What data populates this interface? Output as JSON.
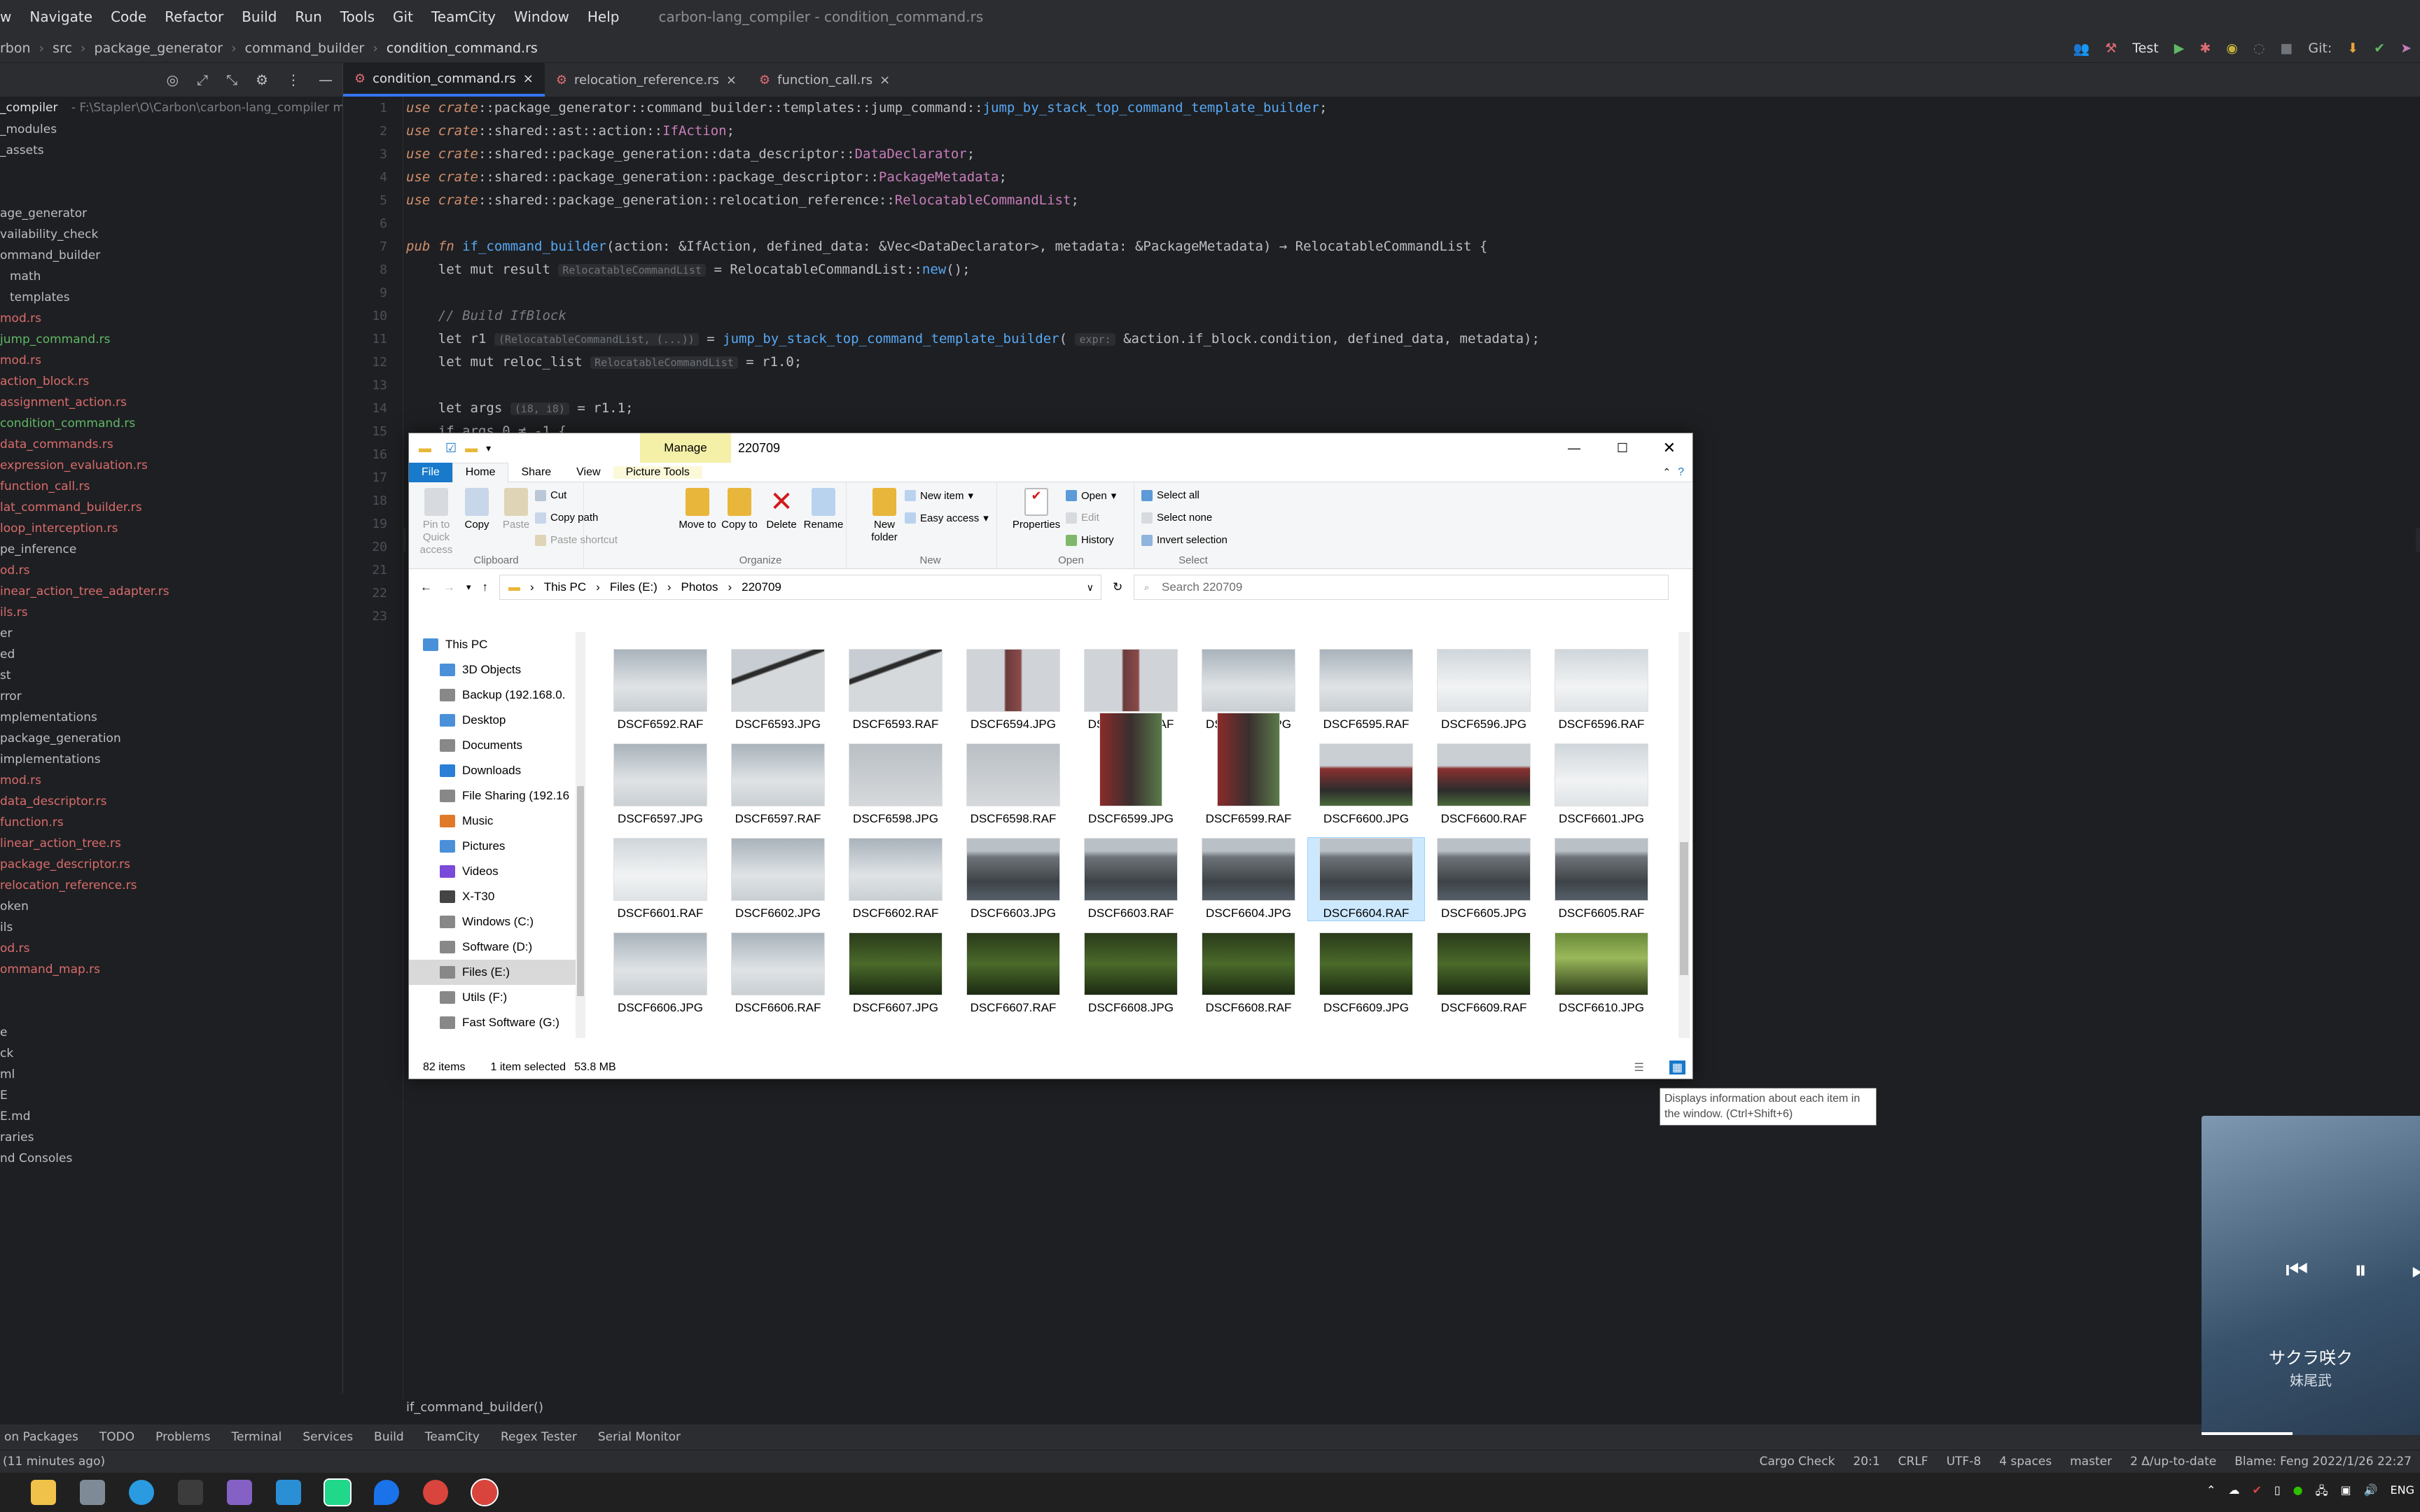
{
  "ide": {
    "menu": [
      "w",
      "Navigate",
      "Code",
      "Refactor",
      "Build",
      "Run",
      "Tools",
      "Git",
      "TeamCity",
      "Window",
      "Help"
    ],
    "window_title": "carbon-lang_compiler - condition_command.rs",
    "breadcrumb": [
      "rbon",
      "src",
      "package_generator",
      "command_builder",
      "condition_command.rs"
    ],
    "run_config": "Test",
    "git_label": "Git:",
    "project_root": "_compiler",
    "project_path": "- F:\\Stapler\\O\\Carbon\\carbon-lang_compiler mas",
    "tree": [
      "_modules",
      "_assets",
      "",
      "",
      "age_generator",
      "vailability_check",
      "ommand_builder",
      "math",
      "templates",
      "mod.rs",
      "jump_command.rs",
      "mod.rs",
      "action_block.rs",
      "assignment_action.rs",
      "condition_command.rs",
      "data_commands.rs",
      "expression_evaluation.rs",
      "function_call.rs",
      "lat_command_builder.rs",
      "loop_interception.rs",
      "pe_inference",
      "od.rs",
      "inear_action_tree_adapter.rs",
      "ils.rs",
      "er",
      "ed",
      "st",
      "rror",
      "mplementations",
      "package_generation",
      "implementations",
      "mod.rs",
      "data_descriptor.rs",
      "function.rs",
      "linear_action_tree.rs",
      "package_descriptor.rs",
      "relocation_reference.rs",
      "oken",
      "ils",
      "od.rs",
      "ommand_map.rs",
      "",
      "",
      "e",
      "ck",
      "ml",
      "E",
      "E.md",
      "raries",
      "nd Consoles"
    ],
    "tabs": [
      {
        "label": "condition_command.rs",
        "active": true
      },
      {
        "label": "relocation_reference.rs",
        "active": false
      },
      {
        "label": "function_call.rs",
        "active": false
      }
    ],
    "line_numbers": [
      "1",
      "2",
      "3",
      "4",
      "5",
      "6",
      "7",
      "8",
      "9",
      "10",
      "11",
      "12",
      "13",
      "14",
      "15",
      "16",
      "17",
      "18",
      "19",
      "20",
      "21",
      "22",
      "23"
    ],
    "code": {
      "l1": {
        "kw": "use crate",
        "p": "::package_generator::command_builder::templates::jump_command::",
        "fn": "jump_by_stack_top_command_template_builder",
        ";": ";"
      },
      "l2": {
        "kw": "use crate",
        "p": "::shared::ast::action::",
        "ty": "IfAction",
        ";": ";"
      },
      "l3": {
        "kw": "use crate",
        "p": "::shared::package_generation::data_descriptor::",
        "ty": "DataDeclarator",
        ";": ";"
      },
      "l4": {
        "kw": "use crate",
        "p": "::shared::package_generation::package_descriptor::",
        "ty": "PackageMetadata",
        ";": ";"
      },
      "l5": {
        "kw": "use crate",
        "p": "::shared::package_generation::relocation_reference::",
        "ty": "RelocatableCommandList",
        ";": ";"
      },
      "l7a": "pub fn ",
      "l7fn": "if_command_builder",
      "l7b": "(action: &IfAction, defined_data: &Vec<DataDeclarator>, metadata: &PackageMetadata) → RelocatableCommandList {",
      "l8a": "    let mut result ",
      "l8hint": "RelocatableCommandList",
      "l8b": " = RelocatableCommandList::",
      "l8fn": "new",
      "l8c": "();",
      "l10": "    // Build IfBlock",
      "l11a": "    let r1 ",
      "l11hint": "(RelocatableCommandList, (...))",
      "l11b": " = ",
      "l11fn": "jump_by_stack_top_command_template_builder",
      "l11hint2": "expr:",
      "l11c": "&action.if_block.condition, defined_data, metadata);",
      "l12a": "    let mut reloc_list ",
      "l12hint": "RelocatableCommandList",
      "l12b": " = r1.0;",
      "l14a": "    let args ",
      "l14hint": "(i8, i8)",
      "l14b": " = r1.1;",
      "l15": "    if args.0 ≠ -1 {"
    },
    "editor_breadcrumb": "if_command_builder()",
    "tool_windows": [
      "on Packages",
      "TODO",
      "Problems",
      "Terminal",
      "Services",
      "Build",
      "TeamCity",
      "Regex Tester",
      "Serial Monitor"
    ],
    "status_left": "(11 minutes ago)",
    "status_right": [
      "Cargo Check",
      "20:1",
      "CRLF",
      "UTF-8",
      "4 spaces",
      "master",
      "2 Δ/up-to-date",
      "Blame: Feng 2022/1/26 22:27"
    ]
  },
  "explorer": {
    "title": "220709",
    "manage_tab": "Manage",
    "picture_tools": "Picture Tools",
    "ribbon_tabs": [
      "File",
      "Home",
      "Share",
      "View"
    ],
    "clipboard": {
      "pin": "Pin to Quick access",
      "copy": "Copy",
      "paste": "Paste",
      "cut": "Cut",
      "copy_path": "Copy path",
      "paste_shortcut": "Paste shortcut",
      "label": "Clipboard"
    },
    "organize": {
      "move": "Move to",
      "copy": "Copy to",
      "delete": "Delete",
      "rename": "Rename",
      "label": "Organize"
    },
    "new": {
      "folder": "New folder",
      "item": "New item",
      "easy": "Easy access",
      "label": "New"
    },
    "open": {
      "properties": "Properties",
      "open": "Open",
      "edit": "Edit",
      "history": "History",
      "label": "Open"
    },
    "select": {
      "all": "Select all",
      "none": "Select none",
      "invert": "Invert selection",
      "label": "Select"
    },
    "path": [
      "This PC",
      "Files (E:)",
      "Photos",
      "220709"
    ],
    "search_placeholder": "Search 220709",
    "nav": [
      "This PC",
      "3D Objects",
      "Backup (192.168.0.",
      "Desktop",
      "Documents",
      "Downloads",
      "File Sharing (192.16",
      "Music",
      "Pictures",
      "Videos",
      "X-T30",
      "Windows (C:)",
      "Software (D:)",
      "Files (E:)",
      "Utils (F:)",
      "Fast Software (G:)"
    ],
    "files": [
      {
        "name": "DSCF6592.RAF",
        "kind": "sky"
      },
      {
        "name": "DSCF6593.JPG",
        "kind": "lamp"
      },
      {
        "name": "DSCF6593.RAF",
        "kind": "lamp"
      },
      {
        "name": "DSCF6594.JPG",
        "kind": "sign"
      },
      {
        "name": "DSCF6594.RAF",
        "kind": "sign"
      },
      {
        "name": "DSCF6595.JPG",
        "kind": "sky"
      },
      {
        "name": "DSCF6595.RAF",
        "kind": "sky"
      },
      {
        "name": "DSCF6596.JPG",
        "kind": "sky2"
      },
      {
        "name": "DSCF6596.RAF",
        "kind": "sky2"
      },
      {
        "name": "DSCF6597.JPG",
        "kind": "sky"
      },
      {
        "name": "DSCF6597.RAF",
        "kind": "sky"
      },
      {
        "name": "DSCF6598.JPG",
        "kind": "sky3"
      },
      {
        "name": "DSCF6598.RAF",
        "kind": "sky3"
      },
      {
        "name": "DSCF6599.JPG",
        "kind": "tall"
      },
      {
        "name": "DSCF6599.RAF",
        "kind": "tall"
      },
      {
        "name": "DSCF6600.JPG",
        "kind": "bldg"
      },
      {
        "name": "DSCF6600.RAF",
        "kind": "bldg"
      },
      {
        "name": "DSCF6601.JPG",
        "kind": "sky2"
      },
      {
        "name": "DSCF6601.RAF",
        "kind": "sky2"
      },
      {
        "name": "DSCF6602.JPG",
        "kind": "sky"
      },
      {
        "name": "DSCF6602.RAF",
        "kind": "sky"
      },
      {
        "name": "DSCF6603.JPG",
        "kind": "tower"
      },
      {
        "name": "DSCF6603.RAF",
        "kind": "tower"
      },
      {
        "name": "DSCF6604.JPG",
        "kind": "tower"
      },
      {
        "name": "DSCF6604.RAF",
        "kind": "tower",
        "selected": true
      },
      {
        "name": "DSCF6605.JPG",
        "kind": "tower"
      },
      {
        "name": "DSCF6605.RAF",
        "kind": "tower"
      },
      {
        "name": "DSCF6606.JPG",
        "kind": "sky"
      },
      {
        "name": "DSCF6606.RAF",
        "kind": "sky"
      },
      {
        "name": "DSCF6607.JPG",
        "kind": "tree"
      },
      {
        "name": "DSCF6607.RAF",
        "kind": "tree"
      },
      {
        "name": "DSCF6608.JPG",
        "kind": "tree"
      },
      {
        "name": "DSCF6608.RAF",
        "kind": "tree"
      },
      {
        "name": "DSCF6609.JPG",
        "kind": "tree"
      },
      {
        "name": "DSCF6609.RAF",
        "kind": "tree"
      },
      {
        "name": "DSCF6610.JPG",
        "kind": "tree2"
      }
    ],
    "status": {
      "count": "82 items",
      "selected": "1 item selected",
      "size": "53.8 MB"
    }
  },
  "tooltip": "Displays information about each item in the window.  (Ctrl+Shift+6)",
  "media": {
    "song": "サクラ咲ク",
    "artist": "妹尾武"
  },
  "colors": {
    "accent": "#3574f0",
    "explorer_blue": "#1979ca",
    "manage": "#f4f0a8"
  }
}
